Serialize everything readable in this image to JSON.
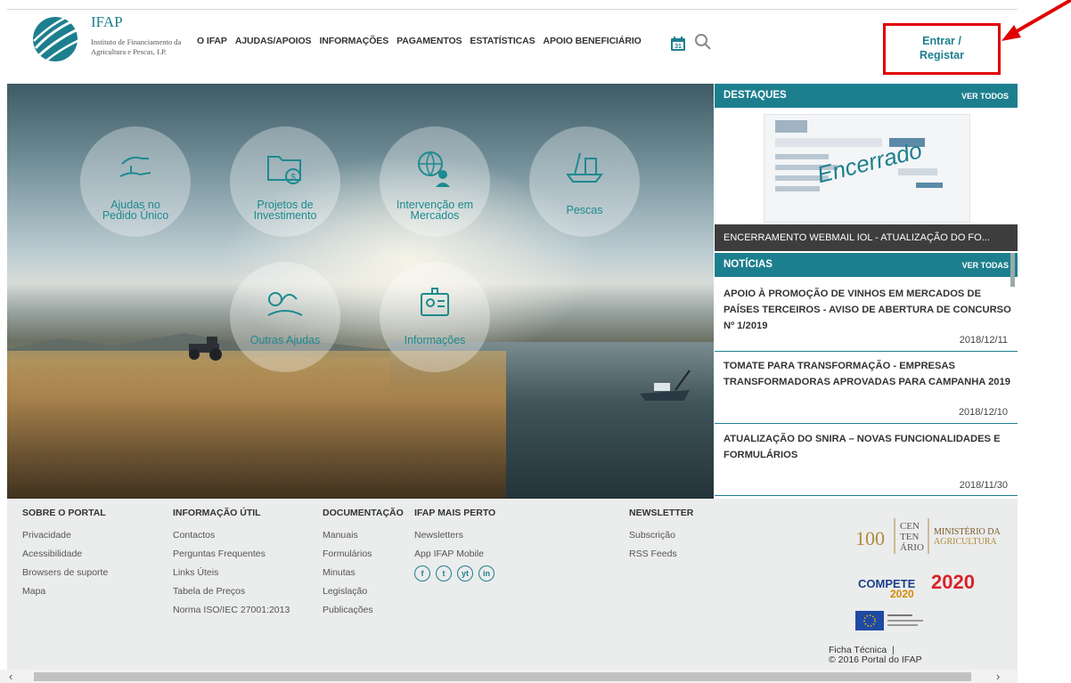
{
  "header": {
    "logo_title": "IFAP",
    "logo_subtitle": "Instituto de Financiamento da Agricultura e Pescas, I.P.",
    "nav": [
      "O IFAP",
      "AJUDAS/APOIOS",
      "INFORMAÇÕES",
      "PAGAMENTOS",
      "ESTATÍSTICAS",
      "APOIO BENEFICIÁRIO"
    ],
    "calendar_day": "31",
    "login_line1": "Entrar /",
    "login_line2": "Registar"
  },
  "hero": {
    "circles": [
      {
        "label1": "Ajudas no",
        "label2": "Pedido Único",
        "icon": "hands-icon"
      },
      {
        "label1": "Projetos de",
        "label2": "Investimento",
        "icon": "folder-money-icon"
      },
      {
        "label1": "Intervenção em",
        "label2": "Mercados",
        "icon": "globe-person-icon"
      },
      {
        "label1": "Pescas",
        "label2": "",
        "icon": "boat-icon"
      },
      {
        "label1": "Outras Ajudas",
        "label2": "",
        "icon": "landscape-icon"
      },
      {
        "label1": "Informações",
        "label2": "",
        "icon": "id-card-icon"
      }
    ]
  },
  "destaques": {
    "title": "DESTAQUES",
    "view_all": "VER TODOS",
    "image_text": "Encerrado",
    "caption": "ENCERRAMENTO WEBMAIL IOL - ATUALIZAÇÃO DO FO..."
  },
  "noticias": {
    "title": "NOTÍCIAS",
    "view_all": "VER TODAS",
    "items": [
      {
        "headline": "APOIO À PROMOÇÃO DE VINHOS EM MERCADOS DE PAÍSES TERCEIROS - AVISO DE ABERTURA DE CONCURSO Nº 1/2019",
        "date": "2018/12/11"
      },
      {
        "headline": "TOMATE PARA TRANSFORMAÇÃO - EMPRESAS TRANSFORMADORAS APROVADAS PARA CAMPANHA 2019",
        "date": "2018/12/10"
      },
      {
        "headline": "ATUALIZAÇÃO DO SNIRA – NOVAS FUNCIONALIDADES E FORMULÁRIOS",
        "date": "2018/11/30"
      }
    ]
  },
  "footer": {
    "columns": [
      {
        "heading": "SOBRE O PORTAL",
        "items": [
          "Privacidade",
          "Acessibilidade",
          "Browsers de suporte",
          "Mapa"
        ]
      },
      {
        "heading": "INFORMAÇÃO ÚTIL",
        "items": [
          "Contactos",
          "Perguntas Frequentes",
          "Links Úteis",
          "Tabela de Preços",
          "Norma ISO/IEC 27001:2013"
        ]
      },
      {
        "heading": "DOCUMENTAÇÃO",
        "items": [
          "Manuais",
          "Formulários",
          "Minutas",
          "Legislação",
          "Publicações"
        ]
      },
      {
        "heading": "IFAP MAIS PERTO",
        "items": [
          "Newsletters",
          "App IFAP Mobile"
        ]
      },
      {
        "heading": "NEWSLETTER",
        "items": [
          "Subscrição",
          "RSS Feeds"
        ]
      }
    ],
    "social": [
      "f",
      "t",
      "yt",
      "in"
    ],
    "compete_text": "COMPETE",
    "compete_year": "2020",
    "portugal2020": "2020",
    "ficha": "Ficha Técnica",
    "copyright": "© 2016 Portal do IFAP"
  },
  "colors": {
    "accent": "#1d7f8e",
    "highlight": "#e00000"
  }
}
